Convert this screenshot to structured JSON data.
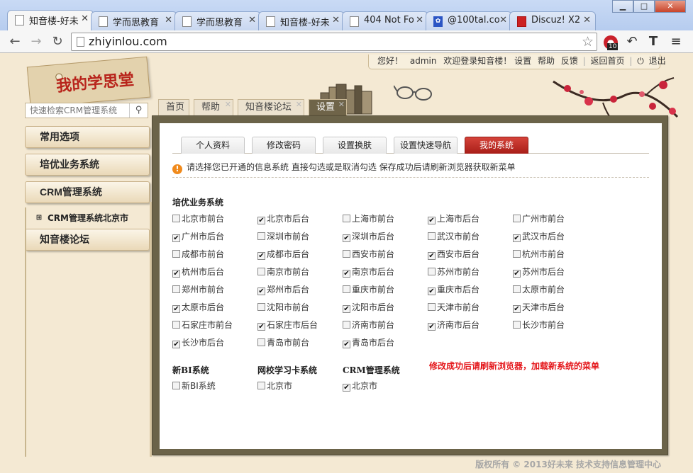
{
  "browser": {
    "tabs": [
      {
        "title": "知音楼-好未",
        "active": true,
        "icon": "page-icon"
      },
      {
        "title": "学而思教育",
        "active": false,
        "icon": "page-icon"
      },
      {
        "title": "学而思教育",
        "active": false,
        "icon": "page-icon"
      },
      {
        "title": "知音楼-好未",
        "active": false,
        "icon": "page-icon"
      },
      {
        "title": "404 Not Fo",
        "active": false,
        "icon": "page-icon"
      },
      {
        "title": "@100tal.co",
        "active": false,
        "icon": "paw-icon"
      },
      {
        "title": "Discuz! X2",
        "active": false,
        "icon": "discuz-icon"
      }
    ],
    "url": "zhiyinlou.com",
    "extension_badge": "10"
  },
  "logo": {
    "text": "我的学思堂"
  },
  "search": {
    "placeholder": "快速检索CRM管理系统"
  },
  "sidebar": {
    "items": [
      "常用选项",
      "培优业务系统",
      "CRM管理系统"
    ],
    "sub_item": "CRM管理系统北京市",
    "last_item": "知音楼论坛"
  },
  "greeting": {
    "hello": "您好！",
    "user": "admin",
    "welcome": "欢迎登录知音楼！",
    "links": [
      "设置",
      "帮助",
      "反馈"
    ],
    "home": "返回首页",
    "logout": "退出"
  },
  "nav_tabs": [
    "首页",
    "帮助",
    "知音楼论坛",
    "设置"
  ],
  "sub_tabs": [
    "个人资料",
    "修改密码",
    "设置换肤",
    "设置快速导航",
    "我的系统"
  ],
  "notice": "请选择您已开通的信息系统  直接勾选或是取消勾选  保存成功后请刷新浏览器获取新菜单",
  "peiyou": {
    "title": "培优业务系统",
    "rows": [
      [
        {
          "label": "北京市前台",
          "checked": false
        },
        {
          "label": "北京市后台",
          "checked": true
        },
        {
          "label": "上海市前台",
          "checked": false
        },
        {
          "label": "上海市后台",
          "checked": true
        },
        {
          "label": "广州市前台",
          "checked": false
        }
      ],
      [
        {
          "label": "广州市后台",
          "checked": true
        },
        {
          "label": "深圳市前台",
          "checked": false
        },
        {
          "label": "深圳市后台",
          "checked": true
        },
        {
          "label": "武汉市前台",
          "checked": false
        },
        {
          "label": "武汉市后台",
          "checked": true
        }
      ],
      [
        {
          "label": "成都市前台",
          "checked": false
        },
        {
          "label": "成都市后台",
          "checked": true
        },
        {
          "label": "西安市前台",
          "checked": false
        },
        {
          "label": "西安市后台",
          "checked": true
        },
        {
          "label": "杭州市前台",
          "checked": false
        }
      ],
      [
        {
          "label": "杭州市后台",
          "checked": true
        },
        {
          "label": "南京市前台",
          "checked": false
        },
        {
          "label": "南京市后台",
          "checked": true
        },
        {
          "label": "苏州市前台",
          "checked": false
        },
        {
          "label": "苏州市后台",
          "checked": true
        }
      ],
      [
        {
          "label": "郑州市前台",
          "checked": false
        },
        {
          "label": "郑州市后台",
          "checked": true
        },
        {
          "label": "重庆市前台",
          "checked": false
        },
        {
          "label": "重庆市后台",
          "checked": true
        },
        {
          "label": "太原市前台",
          "checked": false
        }
      ],
      [
        {
          "label": "太原市后台",
          "checked": true
        },
        {
          "label": "沈阳市前台",
          "checked": false
        },
        {
          "label": "沈阳市后台",
          "checked": true
        },
        {
          "label": "天津市前台",
          "checked": false
        },
        {
          "label": "天津市后台",
          "checked": true
        }
      ],
      [
        {
          "label": "石家庄市前台",
          "checked": false
        },
        {
          "label": "石家庄市后台",
          "checked": true
        },
        {
          "label": "济南市前台",
          "checked": false
        },
        {
          "label": "济南市后台",
          "checked": true
        },
        {
          "label": "长沙市前台",
          "checked": false
        }
      ],
      [
        {
          "label": "长沙市后台",
          "checked": true
        },
        {
          "label": "青岛市前台",
          "checked": false
        },
        {
          "label": "青岛市后台",
          "checked": true
        }
      ]
    ]
  },
  "other_systems": [
    {
      "title": "新BI系统",
      "option": {
        "label": "新BI系统",
        "checked": false
      }
    },
    {
      "title": "网校学习卡系统",
      "option": {
        "label": "北京市",
        "checked": false
      }
    },
    {
      "title": "CRM管理系统",
      "option": {
        "label": "北京市",
        "checked": true
      }
    }
  ],
  "warning": "修改成功后请刷新浏览器，加载新系统的菜单",
  "footer": "版权所有 © 2013好未来 技术支持信息管理中心",
  "colors": {
    "accent_red": "#b8241b",
    "warning_red": "#e4161a",
    "frame": "#6b6349"
  }
}
